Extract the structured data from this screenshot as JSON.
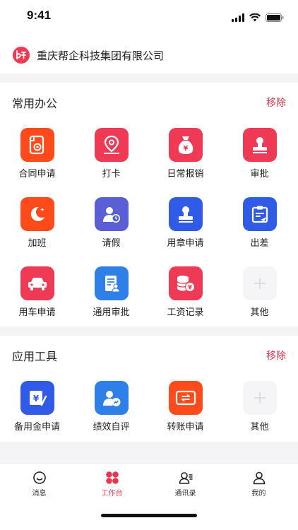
{
  "status": {
    "time": "9:41"
  },
  "company": {
    "name": "重庆帮企科技集团有限公司",
    "logo_icon": "company-logo-icon"
  },
  "colors": {
    "accent": "#e8384f",
    "red": "#ee3a55",
    "orange": "#ff4a1c",
    "blue": "#2f5be8",
    "purple": "#5b5fd6",
    "sky": "#2f7fe8"
  },
  "office": {
    "title": "常用办公",
    "action": "移除",
    "items": [
      {
        "label": "合同申请",
        "icon": "contract-icon"
      },
      {
        "label": "打卡",
        "icon": "location-pin-icon"
      },
      {
        "label": "日常报销",
        "icon": "money-bag-icon"
      },
      {
        "label": "审批",
        "icon": "stamp-icon"
      },
      {
        "label": "加班",
        "icon": "moon-icon"
      },
      {
        "label": "请假",
        "icon": "user-clock-icon"
      },
      {
        "label": "用章申请",
        "icon": "seal-icon"
      },
      {
        "label": "出差",
        "icon": "clipboard-plane-icon"
      },
      {
        "label": "用车申请",
        "icon": "car-icon"
      },
      {
        "label": "通用审批",
        "icon": "document-user-icon"
      },
      {
        "label": "工资记录",
        "icon": "coin-stack-icon"
      },
      {
        "label": "其他",
        "icon": "plus-icon"
      }
    ]
  },
  "tools": {
    "title": "应用工具",
    "action": "移除",
    "items": [
      {
        "label": "备用金申请",
        "icon": "yuan-pen-icon"
      },
      {
        "label": "绩效自评",
        "icon": "user-chart-icon"
      },
      {
        "label": "转账申请",
        "icon": "card-transfer-icon"
      },
      {
        "label": "其他",
        "icon": "plus-icon"
      }
    ]
  },
  "tabs": [
    {
      "label": "消息",
      "icon": "smile-message-icon",
      "active": false
    },
    {
      "label": "工作台",
      "icon": "workbench-grid-icon",
      "active": true
    },
    {
      "label": "通讯录",
      "icon": "contacts-icon",
      "active": false
    },
    {
      "label": "我的",
      "icon": "person-icon",
      "active": false
    }
  ]
}
